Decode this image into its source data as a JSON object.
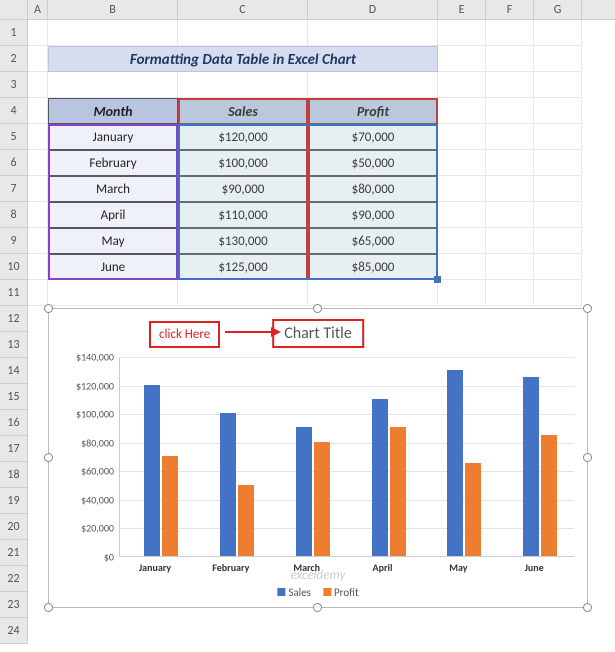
{
  "columns": [
    "A",
    "B",
    "C",
    "D",
    "E",
    "F",
    "G"
  ],
  "title": "Formatting Data Table in Excel Chart",
  "table": {
    "headers": {
      "month": "Month",
      "sales": "Sales",
      "profit": "Profit"
    },
    "rows": [
      {
        "month": "January",
        "sales": "$120,000",
        "profit": "$70,000"
      },
      {
        "month": "February",
        "sales": "$100,000",
        "profit": "$50,000"
      },
      {
        "month": "March",
        "sales": "$90,000",
        "profit": "$80,000"
      },
      {
        "month": "April",
        "sales": "$110,000",
        "profit": "$90,000"
      },
      {
        "month": "May",
        "sales": "$130,000",
        "profit": "$65,000"
      },
      {
        "month": "June",
        "sales": "$125,000",
        "profit": "$85,000"
      }
    ]
  },
  "callout": {
    "label": "click Here",
    "target": "Chart Title"
  },
  "legend": {
    "series1": "Sales",
    "series2": "Profit"
  },
  "y_ticks": [
    "$140,000",
    "$120,000",
    "$100,000",
    "$80,000",
    "$60,000",
    "$40,000",
    "$20,000",
    "$0"
  ],
  "watermark": "exceldemy",
  "chart_data": {
    "type": "bar",
    "title": "Chart Title",
    "categories": [
      "January",
      "February",
      "March",
      "April",
      "May",
      "June"
    ],
    "series": [
      {
        "name": "Sales",
        "values": [
          120000,
          100000,
          90000,
          110000,
          130000,
          125000
        ],
        "color": "#4472c4"
      },
      {
        "name": "Profit",
        "values": [
          70000,
          50000,
          80000,
          90000,
          65000,
          85000
        ],
        "color": "#ed7d31"
      }
    ],
    "ylim": [
      0,
      140000
    ],
    "ylabel": "",
    "xlabel": ""
  }
}
